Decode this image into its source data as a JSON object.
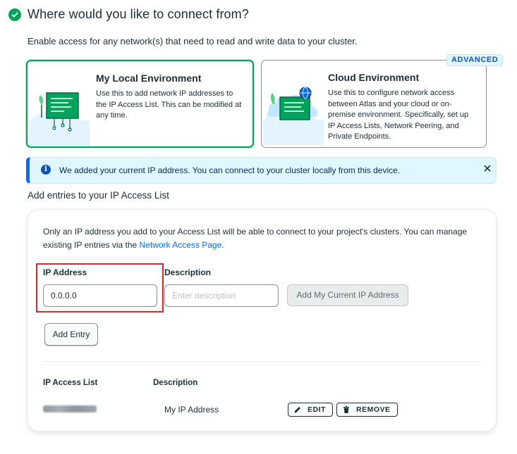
{
  "heading": {
    "title": "Where would you like to connect from?"
  },
  "intro": "Enable access for any network(s) that need to read and write data to your cluster.",
  "environments": {
    "local": {
      "title": "My Local Environment",
      "description": "Use this to add network IP addresses to the IP Access List. This can be modified at any time."
    },
    "cloud": {
      "title": "Cloud Environment",
      "badge": "ADVANCED",
      "description": "Use this to configure network access between Atlas and your cloud or on-premise environment. Specifically, set up IP Access Lists, Network Peering, and Private Endpoints."
    }
  },
  "banner": {
    "text": "We added your current IP address. You can connect to your cluster locally from this device."
  },
  "section_title": "Add entries to your IP Access List",
  "panel": {
    "description_before_link": "Only an IP address you add to your Access List will be able to connect to your project's clusters. You can manage existing IP entries via the ",
    "link": "Network Access Page",
    "description_after_link": ".",
    "ip_label": "IP Address",
    "ip_value": "0.0.0.0",
    "description_label": "Description",
    "description_placeholder": "Enter description",
    "add_current_ip": "Add My Current IP Address",
    "add_entry": "Add Entry"
  },
  "table": {
    "headers": [
      "IP Access List",
      "Description"
    ],
    "rows": [
      {
        "ip": "",
        "description": "My IP Address",
        "edit": "EDIT",
        "remove": "REMOVE"
      }
    ]
  },
  "colors": {
    "accent_green": "#00a35c",
    "link_blue": "#016bf8",
    "highlight_red": "#e0242c",
    "info_bg": "#e1f7ff"
  }
}
